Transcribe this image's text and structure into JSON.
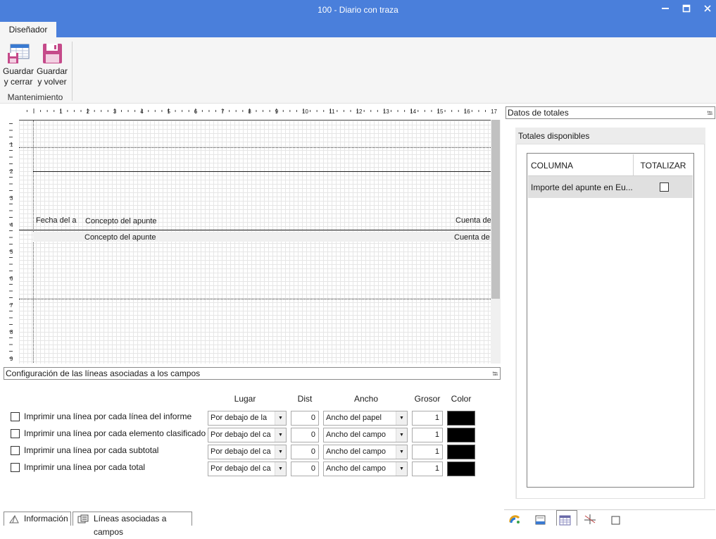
{
  "window": {
    "title": "100 - Diario con traza",
    "minimize": "—",
    "maximize": "□",
    "close": "✕"
  },
  "ribbon": {
    "tab": "Diseñador",
    "buttons": [
      {
        "label1": "Guardar",
        "label2": "y cerrar",
        "icon": "save-close-icon"
      },
      {
        "label1": "Guardar",
        "label2": "y volver",
        "icon": "save-return-icon"
      }
    ],
    "group": "Mantenimiento"
  },
  "designer": {
    "ruler_top": [
      "1",
      "2",
      "3",
      "4",
      "5",
      "6",
      "7",
      "8",
      "9",
      "10",
      "11",
      "12",
      "13",
      "14",
      "15",
      "16",
      "17"
    ],
    "ruler_left": [
      "1",
      "2",
      "3",
      "4",
      "5",
      "6",
      "7",
      "8",
      "9"
    ],
    "header_fields": [
      "Fecha del a",
      "Concepto del apunte",
      "Cuenta de"
    ],
    "detail_fields": [
      "Concepto del apunte",
      "Cuenta de"
    ]
  },
  "lines_panel": {
    "title": "Configuración de las líneas asociadas a los campos",
    "columns": {
      "lugar": "Lugar",
      "dist": "Dist",
      "ancho": "Ancho",
      "grosor": "Grosor",
      "color": "Color"
    },
    "rows": [
      {
        "label": "Imprimir una línea por cada línea del informe",
        "lugar": "Por debajo de la",
        "dist": "0",
        "ancho": "Ancho del papel",
        "grosor": "1",
        "color": "#000000"
      },
      {
        "label": "Imprimir una línea por cada elemento clasificado",
        "lugar": "Por debajo del ca",
        "dist": "0",
        "ancho": "Ancho del campo",
        "grosor": "1",
        "color": "#000000"
      },
      {
        "label": "Imprimir una línea por cada subtotal",
        "lugar": "Por debajo del ca",
        "dist": "0",
        "ancho": "Ancho del campo",
        "grosor": "1",
        "color": "#000000"
      },
      {
        "label": "Imprimir una línea por cada total",
        "lugar": "Por debajo del ca",
        "dist": "0",
        "ancho": "Ancho del campo",
        "grosor": "1",
        "color": "#000000"
      }
    ]
  },
  "totals_panel": {
    "title": "Datos de totales",
    "group_label": "Totales disponibles",
    "headers": {
      "column": "COLUMNA",
      "totalize": "TOTALIZAR"
    },
    "rows": [
      {
        "column": "Importe del apunte en Eu...",
        "checked": false
      }
    ]
  },
  "bottom_tabs": [
    "Información",
    "Líneas asociadas a campos"
  ],
  "colors": {
    "titlebar": "#4a7fdb",
    "accent": "#4a7fdb"
  }
}
